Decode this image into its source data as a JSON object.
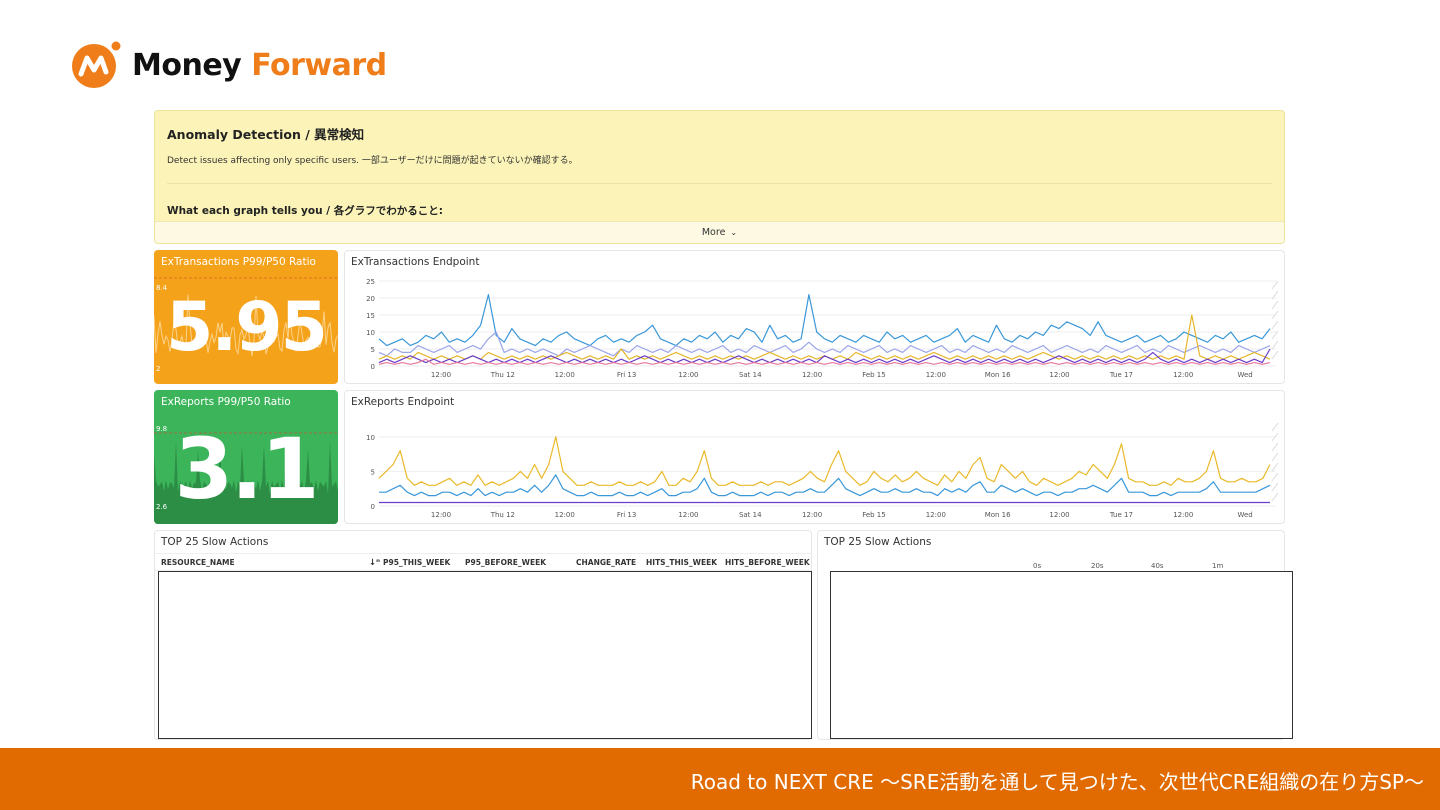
{
  "logo": {
    "word1": "Money",
    "word2": "Forward",
    "icon": "money-forward-logo-icon"
  },
  "note": {
    "title": "Anomaly Detection / 異常検知",
    "description": "Detect issues affecting only specific users. 一部ユーザーだけに問題が起きていないか確認する。",
    "subtitle": "What each graph tells you / 各グラフでわかること:",
    "more_label": "More"
  },
  "colors": {
    "orange_widget": "#f5a21b",
    "green_widget": "#3cb55a",
    "footer": "#e16b00",
    "note_bg": "#fbf3b7"
  },
  "widgets": {
    "qv_transactions": {
      "title": "ExTransactions P99/P50 Ratio",
      "value": "5.95",
      "max_tick": "8.4",
      "min_tick": "2"
    },
    "qv_reports": {
      "title": "ExReports P99/P50 Ratio",
      "value": "3.1",
      "max_tick": "9.8",
      "min_tick": "2.6"
    },
    "ts_transactions": {
      "title": "ExTransactions Endpoint"
    },
    "ts_reports": {
      "title": "ExReports Endpoint"
    },
    "table_left": {
      "title": "TOP 25 Slow Actions",
      "columns": [
        "RESOURCE_NAME",
        "P95_THIS_WEEK",
        "P95_BEFORE_WEEK",
        "CHANGE_RATE",
        "HITS_THIS_WEEK",
        "HITS_BEFORE_WEEK"
      ]
    },
    "table_right": {
      "title": "TOP 25 Slow Actions",
      "axis": [
        "0s",
        "20s",
        "40s",
        "1m"
      ]
    }
  },
  "chart_data": [
    {
      "type": "line",
      "x_ticks": [
        "12:00",
        "Thu 12",
        "12:00",
        "Fri 13",
        "12:00",
        "Sat 14",
        "12:00",
        "Feb 15",
        "12:00",
        "Mon 16",
        "12:00",
        "Tue 17",
        "12:00",
        "Wed"
      ],
      "y_ticks": [
        "25",
        "20",
        "15",
        "10",
        "5",
        "0"
      ],
      "ylim": [
        0,
        25
      ],
      "series": [
        {
          "color": "#3a97d8",
          "values": [
            8,
            6,
            7,
            8,
            6,
            7,
            9,
            8,
            10,
            7,
            8,
            7,
            9,
            12,
            21,
            9,
            7,
            11,
            8,
            7,
            6,
            8,
            7,
            9,
            10,
            8,
            7,
            6,
            8,
            9,
            7,
            8,
            7,
            9,
            10,
            12,
            8,
            7,
            6,
            8,
            7,
            9,
            8,
            10,
            7,
            9,
            8,
            11,
            10,
            7,
            12,
            8,
            9,
            7,
            8,
            21,
            10,
            8,
            7,
            9,
            8,
            7,
            9,
            8,
            7,
            10,
            8,
            9,
            7,
            8,
            9,
            7,
            8,
            9,
            11,
            7,
            9,
            8,
            7,
            12,
            8,
            7,
            9,
            8,
            10,
            9,
            12,
            11,
            13,
            12,
            11,
            9,
            13,
            9,
            8,
            7,
            8,
            9,
            7,
            8,
            9,
            7,
            8,
            10,
            9,
            8,
            7,
            9,
            8,
            10,
            7,
            8,
            9,
            8,
            11
          ]
        },
        {
          "color": "#9aa4e8",
          "values": [
            4,
            3,
            5,
            4,
            4,
            6,
            5,
            4,
            5,
            6,
            4,
            5,
            6,
            5,
            8,
            10,
            4,
            5,
            4,
            5,
            4,
            5,
            4,
            3,
            5,
            4,
            5,
            6,
            5,
            4,
            3,
            5,
            4,
            6,
            5,
            4,
            5,
            4,
            6,
            5,
            4,
            5,
            4,
            5,
            6,
            4,
            5,
            4,
            6,
            5,
            4,
            5,
            6,
            4,
            5,
            7,
            5,
            4,
            5,
            4,
            6,
            5,
            4,
            5,
            6,
            4,
            5,
            4,
            6,
            5,
            4,
            5,
            6,
            4,
            5,
            4,
            6,
            5,
            4,
            5,
            4,
            6,
            5,
            4,
            5,
            6,
            4,
            5,
            6,
            5,
            4,
            5,
            4,
            6,
            5,
            4,
            5,
            6,
            4,
            5,
            4,
            6,
            5,
            4,
            5,
            6,
            5,
            4,
            5,
            4,
            6,
            5,
            4,
            5,
            6
          ]
        },
        {
          "color": "#e6b62c",
          "values": [
            2,
            3,
            2,
            3,
            2,
            4,
            3,
            2,
            3,
            2,
            3,
            2,
            3,
            2,
            4,
            3,
            2,
            3,
            2,
            3,
            2,
            3,
            2,
            3,
            4,
            3,
            2,
            3,
            2,
            3,
            2,
            5,
            2,
            3,
            2,
            3,
            2,
            3,
            4,
            3,
            2,
            3,
            2,
            3,
            2,
            3,
            2,
            3,
            2,
            3,
            4,
            3,
            2,
            3,
            2,
            3,
            2,
            3,
            2,
            3,
            2,
            4,
            3,
            2,
            3,
            2,
            3,
            2,
            3,
            2,
            3,
            4,
            3,
            2,
            3,
            2,
            3,
            2,
            3,
            2,
            3,
            2,
            3,
            2,
            3,
            4,
            3,
            2,
            3,
            2,
            3,
            2,
            3,
            2,
            3,
            2,
            3,
            2,
            3,
            2,
            3,
            2,
            3,
            2,
            15,
            3,
            2,
            3,
            2,
            3,
            2,
            3,
            4,
            3,
            2
          ]
        },
        {
          "color": "#6b3fc9",
          "values": [
            1,
            2,
            1,
            2,
            3,
            2,
            1,
            2,
            1,
            2,
            1,
            2,
            3,
            2,
            1,
            2,
            1,
            2,
            1,
            2,
            1,
            2,
            3,
            2,
            1,
            2,
            1,
            2,
            1,
            2,
            1,
            2,
            1,
            2,
            3,
            2,
            1,
            2,
            1,
            2,
            1,
            2,
            1,
            2,
            1,
            2,
            3,
            2,
            1,
            2,
            1,
            2,
            1,
            2,
            1,
            2,
            1,
            3,
            2,
            1,
            2,
            1,
            2,
            1,
            2,
            1,
            2,
            1,
            2,
            1,
            2,
            3,
            2,
            1,
            2,
            1,
            2,
            1,
            2,
            1,
            2,
            1,
            2,
            1,
            2,
            1,
            2,
            3,
            2,
            1,
            2,
            1,
            2,
            1,
            2,
            1,
            2,
            1,
            2,
            4,
            2,
            1,
            2,
            1,
            2,
            1,
            2,
            1,
            2,
            1,
            2,
            1,
            2,
            1,
            5
          ]
        },
        {
          "color": "#e8799c",
          "values": [
            0.5,
            1,
            0.5,
            1,
            0.5,
            1,
            2,
            0.5,
            1,
            0.5,
            1,
            0.5,
            1,
            0.5,
            1,
            0.5,
            1,
            0.5,
            1,
            0.5,
            1,
            0.5,
            1,
            0.5,
            1,
            0.5,
            1,
            0.5,
            1,
            0.5,
            1,
            0.5,
            1,
            0.5,
            1,
            0.5,
            1,
            0.5,
            1,
            0.5,
            1,
            0.5,
            1,
            0.5,
            1,
            0.5,
            1,
            0.5,
            1,
            0.5,
            1,
            0.5,
            1,
            0.5,
            1,
            0.5,
            1,
            0.5,
            1,
            0.5,
            1,
            0.5,
            1,
            0.5,
            1,
            0.5,
            1,
            0.5,
            1,
            0.5,
            1,
            0.5,
            1,
            0.5,
            1,
            0.5,
            1,
            0.5,
            1,
            0.5,
            1,
            0.5,
            1,
            0.5,
            1,
            0.5,
            1,
            0.5,
            1,
            0.5,
            1,
            0.5,
            1,
            0.5,
            1,
            0.5,
            1,
            0.5,
            1,
            0.5,
            1,
            0.5,
            1,
            0.5,
            1,
            0.5,
            1,
            0.5,
            1,
            0.5,
            1,
            0.5,
            1,
            0.5,
            1
          ]
        }
      ]
    },
    {
      "type": "line",
      "x_ticks": [
        "12:00",
        "Thu 12",
        "12:00",
        "Fri 13",
        "12:00",
        "Sat 14",
        "12:00",
        "Feb 15",
        "12:00",
        "Mon 16",
        "12:00",
        "Tue 17",
        "12:00",
        "Wed"
      ],
      "y_ticks": [
        "10",
        "5",
        "0"
      ],
      "ylim": [
        0,
        12
      ],
      "series": [
        {
          "color": "#eab92a",
          "values": [
            4,
            5,
            6,
            8,
            4,
            3,
            3.5,
            3,
            3,
            3.5,
            4,
            3,
            3.5,
            3,
            4.5,
            3,
            3.5,
            3,
            3.5,
            4,
            5,
            4,
            6,
            4,
            6,
            10,
            5,
            4,
            3,
            3,
            3.5,
            3,
            3,
            3,
            3.5,
            3,
            3,
            3.5,
            3,
            3.5,
            5,
            3,
            3,
            4,
            3.5,
            5,
            8,
            4,
            3,
            3,
            3.5,
            3,
            3,
            3,
            3.5,
            3,
            3.5,
            3.5,
            3,
            3.5,
            4,
            5,
            4,
            3.5,
            6,
            8,
            5,
            4,
            3,
            3.5,
            5,
            4,
            3.5,
            4.5,
            3.5,
            4,
            5,
            4,
            3.5,
            3,
            4.5,
            3.5,
            5,
            4,
            6,
            7,
            4,
            3.5,
            6,
            5,
            4,
            5,
            3.5,
            3,
            4,
            3.5,
            3,
            3.5,
            4,
            5,
            4.5,
            6,
            5,
            4,
            6,
            9,
            4,
            3.5,
            3.5,
            3,
            3,
            3.5,
            3,
            4,
            3.5,
            3.5,
            4,
            5,
            8,
            4,
            3.5,
            3.5,
            4,
            3.5,
            3.5,
            4,
            6
          ]
        },
        {
          "color": "#3a97d8",
          "values": [
            2,
            2,
            2.5,
            3,
            2,
            1.5,
            2,
            1.5,
            1.5,
            2,
            2,
            1.5,
            2,
            1.5,
            2.5,
            1.5,
            2,
            1.5,
            2,
            2,
            2.5,
            2,
            3,
            2,
            3,
            4.5,
            2.5,
            2,
            1.5,
            1.5,
            2,
            1.5,
            1.5,
            1.5,
            2,
            1.5,
            1.5,
            2,
            1.5,
            2,
            2.5,
            1.5,
            1.5,
            2,
            2,
            2.5,
            4,
            2,
            1.5,
            1.5,
            2,
            1.5,
            1.5,
            1.5,
            2,
            1.5,
            2,
            2,
            1.5,
            2,
            2,
            2.5,
            2,
            2,
            3,
            4,
            2.5,
            2,
            1.5,
            2,
            2.5,
            2,
            2,
            2.5,
            2,
            2,
            2.5,
            2,
            2,
            1.5,
            2.5,
            2,
            2.5,
            2,
            3,
            3.5,
            2,
            2,
            3,
            2.5,
            2,
            2.5,
            2,
            1.5,
            2,
            2,
            1.5,
            2,
            2,
            2.5,
            2.5,
            3,
            2.5,
            2,
            3,
            4,
            2,
            2,
            2,
            1.5,
            1.5,
            2,
            1.5,
            2,
            2,
            2,
            2,
            2.5,
            3.5,
            2,
            2,
            2,
            2,
            2,
            2,
            2.5,
            3
          ]
        },
        {
          "color": "#6b3fc9",
          "values": [
            0.5,
            0.5,
            0.5,
            0.5,
            0.5,
            0.5,
            0.5,
            0.5,
            0.5,
            0.5,
            0.5,
            0.5,
            0.5,
            0.5,
            0.5,
            0.5,
            0.5,
            0.5,
            0.5,
            0.5,
            0.5,
            0.5,
            0.5,
            0.5,
            0.5,
            0.5,
            0.5,
            0.5,
            0.5,
            0.5,
            0.5,
            0.5,
            0.5,
            0.5,
            0.5,
            0.5,
            0.5,
            0.5,
            0.5,
            0.5,
            0.5,
            0.5,
            0.5,
            0.5,
            0.5,
            0.5,
            0.5,
            0.5,
            0.5,
            0.5,
            0.5,
            0.5,
            0.5,
            0.5,
            0.5,
            0.5,
            0.5,
            0.5,
            0.5,
            0.5,
            0.5,
            0.5,
            0.5,
            0.5,
            0.5,
            0.5,
            0.5,
            0.5,
            0.5,
            0.5,
            0.5,
            0.5,
            0.5,
            0.5,
            0.5,
            0.5,
            0.5,
            0.5,
            0.5,
            0.5,
            0.5,
            0.5,
            0.5,
            0.5,
            0.5,
            0.5,
            0.5,
            0.5,
            0.5,
            0.5,
            0.5,
            0.5,
            0.5,
            0.5,
            0.5,
            0.5,
            0.5,
            0.5,
            0.5,
            0.5,
            0.5,
            0.5,
            0.5,
            0.5,
            0.5,
            0.5,
            0.5,
            0.5,
            0.5,
            0.5,
            0.5,
            0.5,
            0.5,
            0.5,
            0.5,
            0.5,
            0.5,
            0.5,
            0.5,
            0.5,
            0.5,
            0.5,
            0.5,
            0.5,
            0.5
          ]
        }
      ]
    }
  ],
  "footer": {
    "text": "Road to NEXT CRE ～SRE活動を通して見つけた、次世代CRE組織の在り方SP～"
  }
}
